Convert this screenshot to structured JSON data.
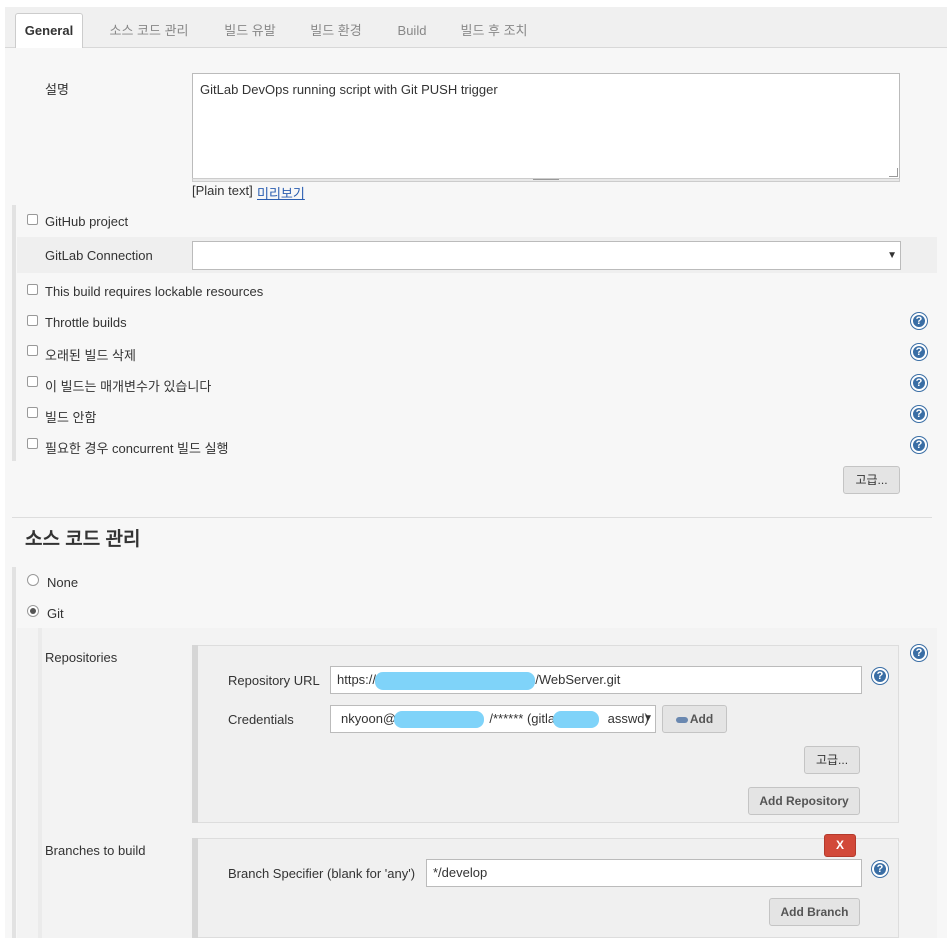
{
  "tabs": [
    "General",
    "소스 코드 관리",
    "빌드 유발",
    "빌드 환경",
    "Build",
    "빌드 후 조치"
  ],
  "general": {
    "description_label": "설명",
    "description_value": "GitLab DevOps running script with Git PUSH trigger",
    "plain_text": "[Plain text]",
    "preview_link": "미리보기",
    "github_project": "GitHub project",
    "gitlab_connection_label": "GitLab Connection",
    "gitlab_connection_value": "",
    "lockable_resources": "This build requires lockable resources",
    "throttle_builds": "Throttle builds",
    "discard_old_builds": "오래된 빌드 삭제",
    "parameterized": "이 빌드는 매개변수가 있습니다",
    "disable_build": "빌드 안함",
    "concurrent_builds": "필요한 경우 concurrent 빌드 실행",
    "advanced_button": "고급..."
  },
  "scm": {
    "section_title": "소스 코드 관리",
    "none_label": "None",
    "git_label": "Git",
    "repositories_label": "Repositories",
    "repo_url_label": "Repository URL",
    "repo_url_prefix": "https://",
    "repo_url_suffix": "/WebServer.git",
    "credentials_label": "Credentials",
    "cred_prefix": "nkyoon@",
    "cred_middle": "/****** (gitlab",
    "cred_suffix": "asswd)",
    "add_button": "Add",
    "advanced_button": "고급...",
    "add_repository_button": "Add Repository",
    "branches_label": "Branches to build",
    "delete_button": "X",
    "branch_specifier_label": "Branch Specifier (blank for 'any')",
    "branch_specifier_value": "*/develop",
    "add_branch_button": "Add Branch"
  },
  "colors": {
    "help_icon": "#3a6ea5",
    "delete_button": "#d24939",
    "link": "#2a5db0",
    "redaction": "#7fd3f9"
  },
  "icons": {
    "help": "question-circle",
    "key": "key-icon",
    "dropdown": "caret-down"
  }
}
